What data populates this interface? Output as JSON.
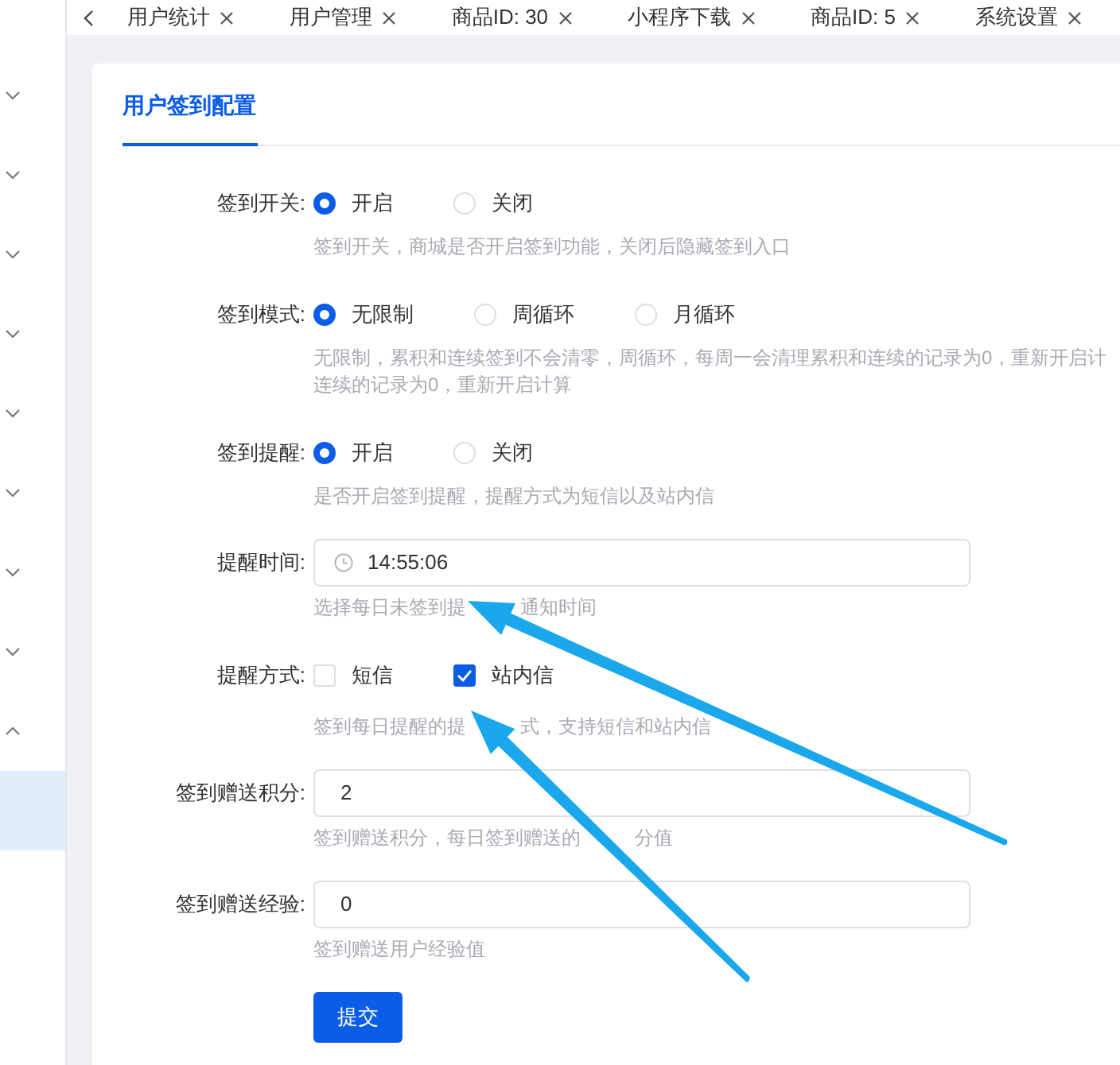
{
  "sidebar": {
    "groups": [
      {
        "expanded": false
      },
      {
        "expanded": false
      },
      {
        "expanded": false
      },
      {
        "expanded": false
      },
      {
        "expanded": false
      },
      {
        "expanded": false
      },
      {
        "expanded": false
      },
      {
        "expanded": false
      },
      {
        "expanded": true
      }
    ]
  },
  "tabs": [
    {
      "label": "用户统计",
      "selected": false
    },
    {
      "label": "用户管理",
      "selected": false
    },
    {
      "label": "商品ID: 30",
      "selected": false
    },
    {
      "label": "小程序下载",
      "selected": false
    },
    {
      "label": "商品ID: 5",
      "selected": false
    },
    {
      "label": "系统设置",
      "selected": false
    }
  ],
  "card": {
    "title": "用户签到配置",
    "fields": [
      {
        "kind": "radio",
        "label": "签到开关:",
        "options": [
          {
            "label": "开启",
            "selected": true
          },
          {
            "label": "关闭",
            "selected": false
          }
        ],
        "hint": [
          [
            "签到开关，商城是否开启签到功能，关闭后隐藏签到入口"
          ]
        ]
      },
      {
        "kind": "radio",
        "label": "签到模式:",
        "options": [
          {
            "label": "无限制",
            "selected": true
          },
          {
            "label": "周循环",
            "selected": false
          },
          {
            "label": "月循环",
            "selected": false
          }
        ],
        "hint": [
          [
            "无限制，累积和连续签到不会清零，周循环，每周一会清理累积和连续的记录为0，重新开启计"
          ],
          [
            "连续的记录为0，重新开启计算"
          ]
        ]
      },
      {
        "kind": "radio",
        "label": "签到提醒:",
        "options": [
          {
            "label": "开启",
            "selected": true
          },
          {
            "label": "关闭",
            "selected": false
          }
        ],
        "hint": [
          [
            "是否开启签到提醒，提醒方式为短信以及站内信"
          ]
        ]
      },
      {
        "kind": "time",
        "label": "提醒时间:",
        "value": "14:55:06",
        "hint": [
          [
            "选择每日未签到提",
            "通知时间"
          ]
        ]
      },
      {
        "kind": "checkbox",
        "label": "提醒方式:",
        "options": [
          {
            "label": "短信",
            "checked": false
          },
          {
            "label": "站内信",
            "checked": true
          }
        ],
        "hint": [
          [
            "签到每日提醒的提",
            "式，支持短信和站内信"
          ]
        ]
      },
      {
        "kind": "number",
        "label": "签到赠送积分:",
        "value": "2",
        "hint": [
          [
            "签到赠送积分，每日签到赠送的",
            "分值"
          ]
        ]
      },
      {
        "kind": "number",
        "label": "签到赠送经验:",
        "value": "0",
        "hint": [
          [
            "签到赠送用户经验值"
          ]
        ]
      }
    ],
    "submit": "提交"
  }
}
